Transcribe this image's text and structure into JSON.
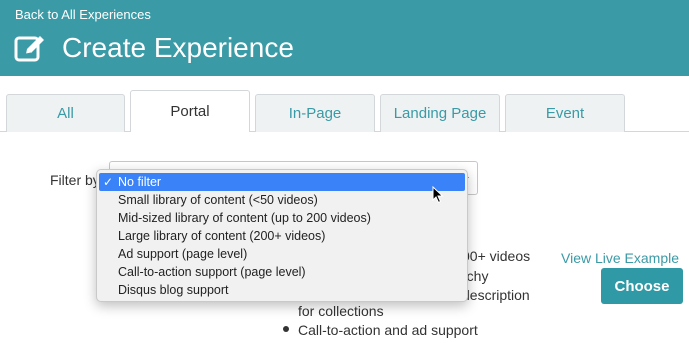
{
  "header": {
    "back_label": "Back to All Experiences",
    "title": "Create Experience",
    "title_icon": "edit-icon",
    "bg_color": "#3a9aa6"
  },
  "tabs": [
    {
      "label": "All",
      "active": false
    },
    {
      "label": "Portal",
      "active": true
    },
    {
      "label": "In-Page",
      "active": false
    },
    {
      "label": "Landing Page",
      "active": false
    },
    {
      "label": "Event",
      "active": false
    }
  ],
  "filter": {
    "label": "Filter by",
    "selected": "No filter",
    "options": [
      "No filter",
      "Small library of content (<50 videos)",
      "Mid-sized library of content (up to 200 videos)",
      "Large library of content (200+ videos)",
      "Ad support (page level)",
      "Call-to-action support (page level)",
      "Disqus blog support"
    ],
    "highlight_color": "#3a82f7"
  },
  "card": {
    "line1": "00+ videos",
    "line2": "rchy",
    "line3": "description",
    "line4": "for collections",
    "bullet": "Call-to-action and ad support",
    "view_live_label": "View Live Example",
    "choose_label": "Choose"
  }
}
